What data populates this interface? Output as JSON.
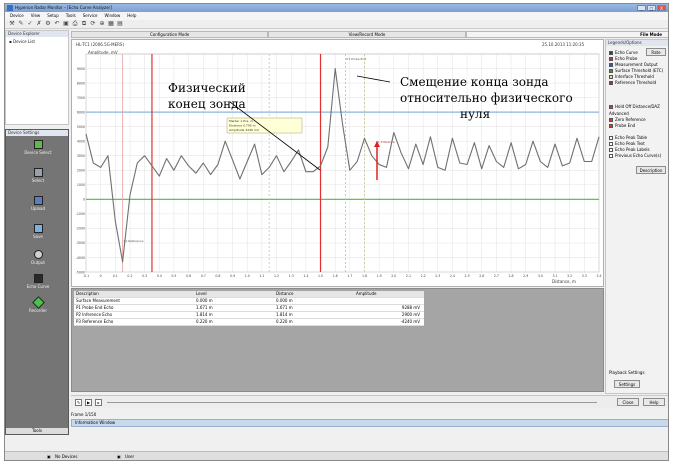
{
  "window": {
    "title": "Hyperion Radar Monitor – [Echo Curve Analyzer]",
    "buttons": [
      "_",
      "□",
      "X"
    ]
  },
  "menu": [
    "Device",
    "View",
    "Setup",
    "Tools",
    "Service",
    "Window",
    "Help"
  ],
  "left_top_pane": {
    "header": "Device Explorer",
    "item": "Device List"
  },
  "tools_pane": {
    "header": "Device Settings",
    "items": [
      "Device Select",
      "Select",
      "Upload",
      "Save",
      "Output",
      "Echo Curve",
      "Recorder"
    ],
    "footer": "Tools"
  },
  "tabs": [
    "Configuration Mode",
    "View/Record Mode",
    "File Mode"
  ],
  "chart_header": {
    "left": "HL-TC1 (2006.5G-MERS)",
    "right": "25.10.2013 11:20:35"
  },
  "chart_data": {
    "type": "line",
    "ylabel": "Amplitude, mV",
    "xlabel": "Distance, m",
    "xlim": [
      -0.1,
      3.4
    ],
    "ylim": [
      -5000,
      10000
    ],
    "yticks": [
      9000,
      8000,
      7000,
      6000,
      5000,
      4000,
      3000,
      2000,
      1000,
      0,
      -1000,
      -2000,
      -3000,
      -4000,
      -5000
    ],
    "xticks": [
      "-0.1",
      "0",
      "0.1",
      "0.2",
      "0.3",
      "0.4",
      "0.5",
      "0.6",
      "0.7",
      "0.8",
      "0.9",
      "1.0",
      "1.1",
      "1.2",
      "1.3",
      "1.4",
      "1.5",
      "1.6",
      "1.7",
      "1.8",
      "1.9",
      "2.0",
      "2.1",
      "2.2",
      "2.3",
      "2.4",
      "2.5",
      "2.6",
      "2.7",
      "2.8",
      "2.9",
      "3.0",
      "3.1",
      "3.2",
      "3.3",
      "3.4"
    ],
    "series": [
      {
        "name": "Echo Curve",
        "color": "#707070",
        "x": [
          -0.1,
          -0.05,
          0,
          0.05,
          0.1,
          0.15,
          0.2,
          0.25,
          0.3,
          0.35,
          0.4,
          0.45,
          0.5,
          0.55,
          0.6,
          0.65,
          0.7,
          0.75,
          0.8,
          0.85,
          0.9,
          0.95,
          1.0,
          1.05,
          1.1,
          1.15,
          1.2,
          1.25,
          1.3,
          1.35,
          1.4,
          1.45,
          1.5,
          1.55,
          1.6,
          1.65,
          1.7,
          1.75,
          1.8,
          1.85,
          1.9,
          1.95,
          2.0,
          2.05,
          2.1,
          2.15,
          2.2,
          2.25,
          2.3,
          2.35,
          2.4,
          2.45,
          2.5,
          2.55,
          2.6,
          2.65,
          2.7,
          2.75,
          2.8,
          2.85,
          2.9,
          2.95,
          3.0,
          3.05,
          3.1,
          3.15,
          3.2,
          3.25,
          3.3,
          3.35,
          3.4
        ],
        "y": [
          4500,
          2500,
          2200,
          3000,
          -1500,
          -4300,
          300,
          2500,
          3000,
          2300,
          1600,
          2800,
          2000,
          3000,
          2300,
          1800,
          2500,
          1700,
          2400,
          4000,
          2700,
          1400,
          2600,
          3800,
          1700,
          2200,
          3000,
          1900,
          2600,
          3400,
          1900,
          1900,
          2300,
          3600,
          9000,
          5200,
          2000,
          2600,
          4200,
          3000,
          2400,
          2200,
          4600,
          3200,
          2100,
          3800,
          2400,
          4300,
          2200,
          2000,
          4200,
          2500,
          2400,
          3900,
          2100,
          3700,
          2600,
          2200,
          3900,
          2100,
          2400,
          4000,
          2600,
          2200,
          3800,
          2300,
          2500,
          4200,
          2600,
          2600,
          4300
        ]
      }
    ],
    "markers": [
      {
        "x": 0.15,
        "color": "#e8a0a0",
        "label": "P1 Reference"
      },
      {
        "x": 0.35,
        "color": "#e03030",
        "label": ""
      },
      {
        "x": 1.15,
        "color": "#c8c890",
        "label": ""
      },
      {
        "x": 1.5,
        "color": "#e03030",
        "label": ""
      },
      {
        "x": 1.67,
        "color": "#a8d080",
        "label": "P1 Probe End"
      },
      {
        "x": 1.8,
        "color": "#c8c890",
        "label": ""
      }
    ],
    "thresholds": [
      {
        "y": 6000,
        "color": "#8ab4e0"
      },
      {
        "y": 0,
        "color": "#40c040"
      }
    ],
    "extra_labels": [
      "P1 Inference"
    ],
    "tooltip": [
      "Marker 1 Pos. m",
      "Distance 0.795 m",
      "Amplitude 3246 mV"
    ],
    "grid": true
  },
  "annotations": {
    "left": [
      "Физический",
      "конец зонда"
    ],
    "right": [
      "Смещение конца зонда",
      "относительно физического",
      "нуля"
    ]
  },
  "right_panel": {
    "header": "Legends/Options",
    "range_button": "Rate",
    "legend_items": [
      {
        "label": "Echo Curve",
        "color": "#404040"
      },
      {
        "label": "Echo Probe",
        "color": "#c03030"
      },
      {
        "label": "Measurement Output",
        "color": "#2060c0"
      },
      {
        "label": "Surface Threshold (ETC)",
        "color": "#30a030"
      },
      {
        "label": "Interface Threshold",
        "color": "#e0e0a0"
      },
      {
        "label": "Reference Threshold",
        "color": "#a03030"
      }
    ],
    "hold_label": "Hold Off Distance/DAZ",
    "advanced_header": "Advanced",
    "advanced_items": [
      {
        "label": "Zero Reference",
        "color": "#e03030"
      },
      {
        "label": "Probe End",
        "color": "#e03030"
      }
    ],
    "check_items": [
      "Echo Peak Table",
      "Echo Peak Text",
      "Echo Peak Labels",
      "Previous Echo Curve(s)"
    ],
    "description_button": "Description",
    "playback_header": "Playback Settings",
    "settings_button": "Settings"
  },
  "table": {
    "columns": [
      "Description",
      "Level",
      "Distance",
      "Amplitude"
    ],
    "rows": [
      [
        "Surface Measurement",
        "0.000 m",
        "0.000 m",
        ""
      ],
      [
        "P1 Probe End Echo",
        "1.671 m",
        "1.671 m",
        "9288 mV"
      ],
      [
        "P2 Inference Echo",
        "1.814 m",
        "1.814 m",
        "2900 mV"
      ],
      [
        "P3 Reference Echo",
        "0.220 m",
        "0.220 m",
        "-4240 mV"
      ]
    ]
  },
  "playback": {
    "close_button": "Close",
    "help_button": "Help"
  },
  "status": {
    "frame": "Frame 1/150"
  },
  "info_bar": "Information Window",
  "taskbar": {
    "devices": "No Devices",
    "user": "User"
  }
}
